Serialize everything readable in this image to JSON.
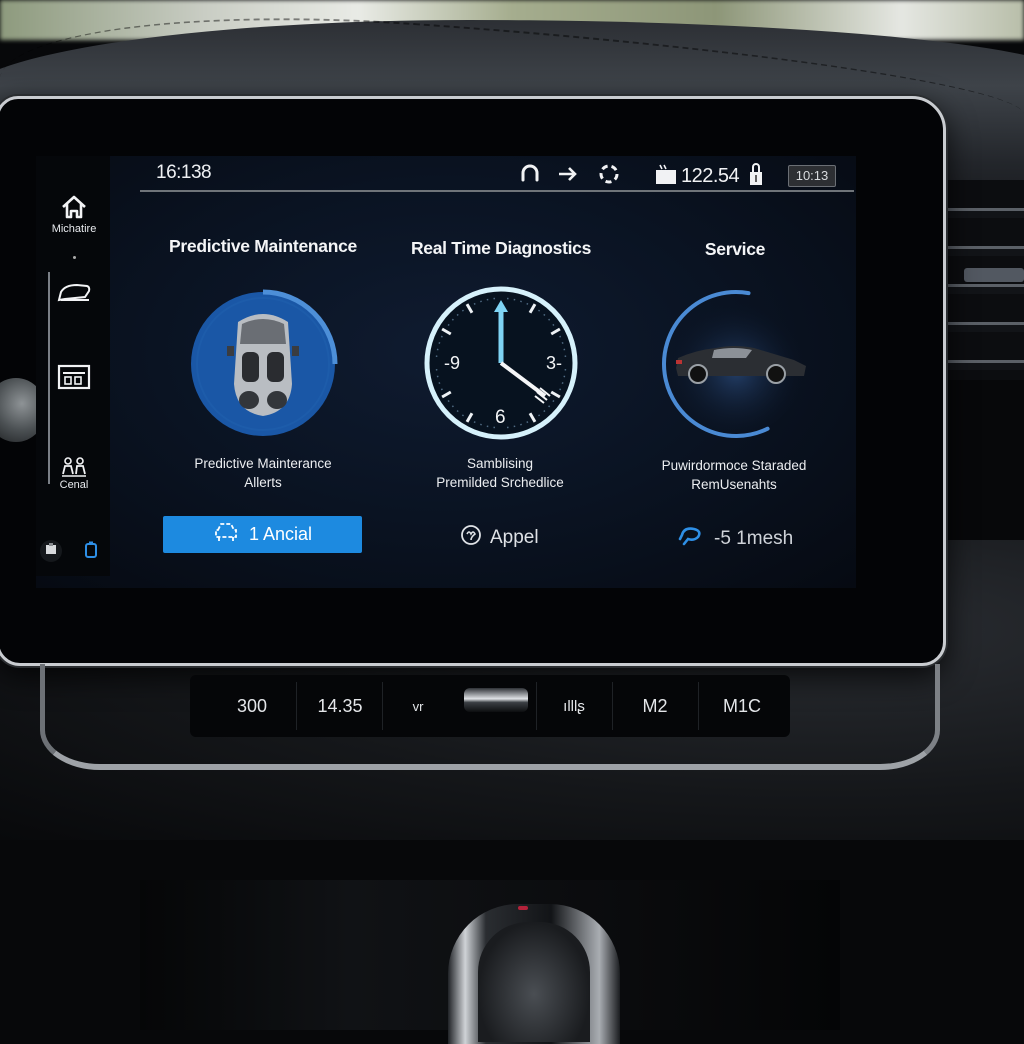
{
  "status_bar": {
    "time": "16:138",
    "icons": [
      "headset-icon",
      "arrow-right-icon",
      "sync-ring-icon",
      "folder-icon"
    ],
    "value": "122.54",
    "lock_icon": "padlock-icon",
    "badge": "10:13"
  },
  "sidebar": {
    "items": [
      {
        "icon": "home-icon",
        "label": "Michatire"
      },
      {
        "icon": "car-outline-icon",
        "label": ""
      },
      {
        "icon": "calendar-panel-icon",
        "label": ""
      },
      {
        "icon": "people-service-icon",
        "label": "Cenal"
      }
    ],
    "bottom_icons": [
      "clipboard-icon",
      "battery-icon"
    ]
  },
  "cards": [
    {
      "title": "Predictive Maintenance",
      "subtitle_lines": [
        "Predictive Mainterance",
        "Allerts"
      ],
      "button": {
        "icon": "car-front-icon",
        "label": "1 Ancial"
      },
      "ring_progress_percent": 25
    },
    {
      "title": "Real Time Diagnostics",
      "subtitle_lines": [
        "Samblising",
        "Premilded Srchedlice"
      ],
      "button": {
        "icon": "appeal-icon",
        "label": "Appel"
      },
      "clock_labels": [
        "-9",
        "3-",
        "6"
      ]
    },
    {
      "title": "Service",
      "subtitle_lines": [
        "Puwirdormoce Staraded",
        "RemUsenahts"
      ],
      "button": {
        "icon": "wrench-loop-icon",
        "label": "-5 1mesh"
      },
      "ring_progress_percent": 60
    }
  ],
  "hardware_buttons": [
    "300",
    "14.35",
    "vr",
    "",
    "ılllʂ",
    "M2",
    "M1C"
  ],
  "colors": {
    "accent": "#1d8ae0",
    "ring_blue": "#1f5fae",
    "clock_hand": "#7fd4f4",
    "screen_bg": "#0a1322",
    "link_blue": "#2e8fe6"
  }
}
